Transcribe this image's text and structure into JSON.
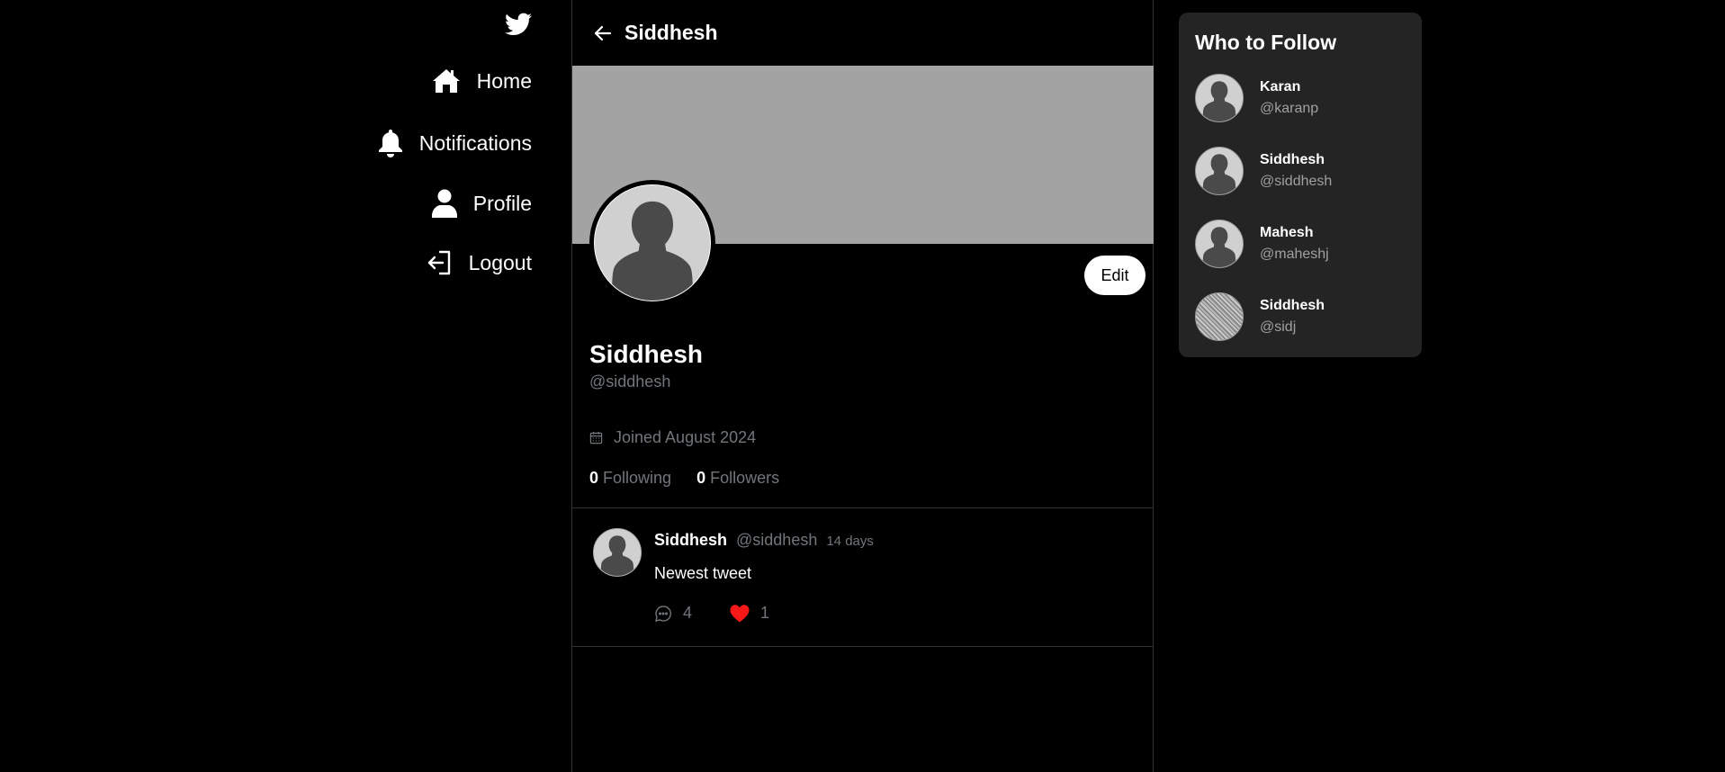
{
  "colors": {
    "background": "#000000",
    "banner": "#a3a3a3",
    "card": "#242424",
    "muted": "#71767b",
    "like": "#f91818"
  },
  "nav": {
    "logo_icon": "twitter-bird-icon",
    "items": [
      {
        "label": "Home",
        "icon": "home-icon"
      },
      {
        "label": "Notifications",
        "icon": "bell-icon"
      },
      {
        "label": "Profile",
        "icon": "user-icon"
      },
      {
        "label": "Logout",
        "icon": "logout-icon"
      }
    ]
  },
  "header": {
    "title": "Siddhesh",
    "back_icon": "arrow-left-icon"
  },
  "profile": {
    "name": "Siddhesh",
    "handle": "@siddhesh",
    "joined": "Joined August 2024",
    "following_count": "0",
    "following_label": "Following",
    "followers_count": "0",
    "followers_label": "Followers",
    "edit_label": "Edit"
  },
  "tweets": [
    {
      "name": "Siddhesh",
      "handle": "@siddhesh",
      "time": "14 days",
      "text": "Newest tweet",
      "comments": "4",
      "likes": "1",
      "liked": true
    }
  ],
  "who_to_follow": {
    "title": "Who to Follow",
    "users": [
      {
        "name": "Karan",
        "handle": "@karanp"
      },
      {
        "name": "Siddhesh",
        "handle": "@siddhesh"
      },
      {
        "name": "Mahesh",
        "handle": "@maheshj"
      },
      {
        "name": "Siddhesh",
        "handle": "@sidj"
      }
    ]
  }
}
